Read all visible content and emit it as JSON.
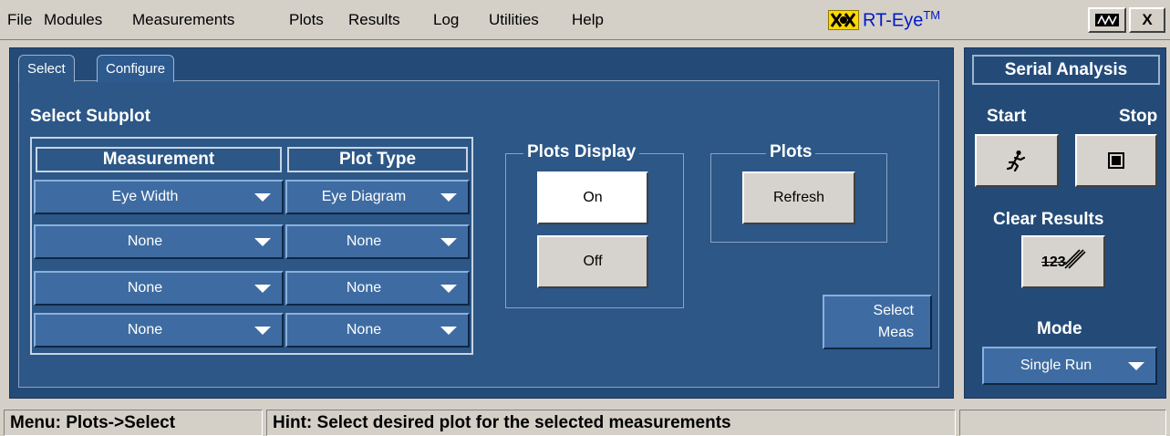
{
  "menu": {
    "items": [
      "File",
      "Modules",
      "Measurements",
      "Plots",
      "Results",
      "Log",
      "Utilities",
      "Help"
    ]
  },
  "brand": {
    "logo_text": "XX",
    "name": "RT-Eye",
    "tm": "TM"
  },
  "window_buttons": {
    "display_icon": "display-icon",
    "close_label": "X"
  },
  "tabs": [
    {
      "label": "Select",
      "active": true
    },
    {
      "label": "Configure",
      "active": false
    }
  ],
  "select_subplot": {
    "title": "Select Subplot",
    "headers": {
      "measurement": "Measurement",
      "plot_type": "Plot Type"
    },
    "rows": [
      {
        "measurement": "Eye Width",
        "plot_type": "Eye Diagram"
      },
      {
        "measurement": "None",
        "plot_type": "None"
      },
      {
        "measurement": "None",
        "plot_type": "None"
      },
      {
        "measurement": "None",
        "plot_type": "None"
      }
    ]
  },
  "plots_display": {
    "title": "Plots Display",
    "on_label": "On",
    "off_label": "Off",
    "selected": "On"
  },
  "plots": {
    "title": "Plots",
    "refresh_label": "Refresh"
  },
  "select_meas": {
    "line1": "Select",
    "line2": "Meas"
  },
  "serial_analysis": {
    "title": "Serial Analysis",
    "start_label": "Start",
    "stop_label": "Stop",
    "start_icon": "running-man-icon",
    "stop_icon": "stop-square-icon",
    "clear_results_label": "Clear Results",
    "clear_icon": "eraser-123-icon",
    "clear_icon_text": "123",
    "mode_label": "Mode",
    "mode_value": "Single Run"
  },
  "status": {
    "menu_path": "Menu: Plots->Select",
    "hint": "Hint: Select desired plot for the selected measurements",
    "extra": ""
  },
  "colors": {
    "panel_blue": "#244b78",
    "inner_blue": "#2c5787",
    "control_blue": "#3e6ca2",
    "chrome_gray": "#d4d0c8",
    "brand_yellow": "#ffd800",
    "brand_blue": "#0018c8"
  }
}
